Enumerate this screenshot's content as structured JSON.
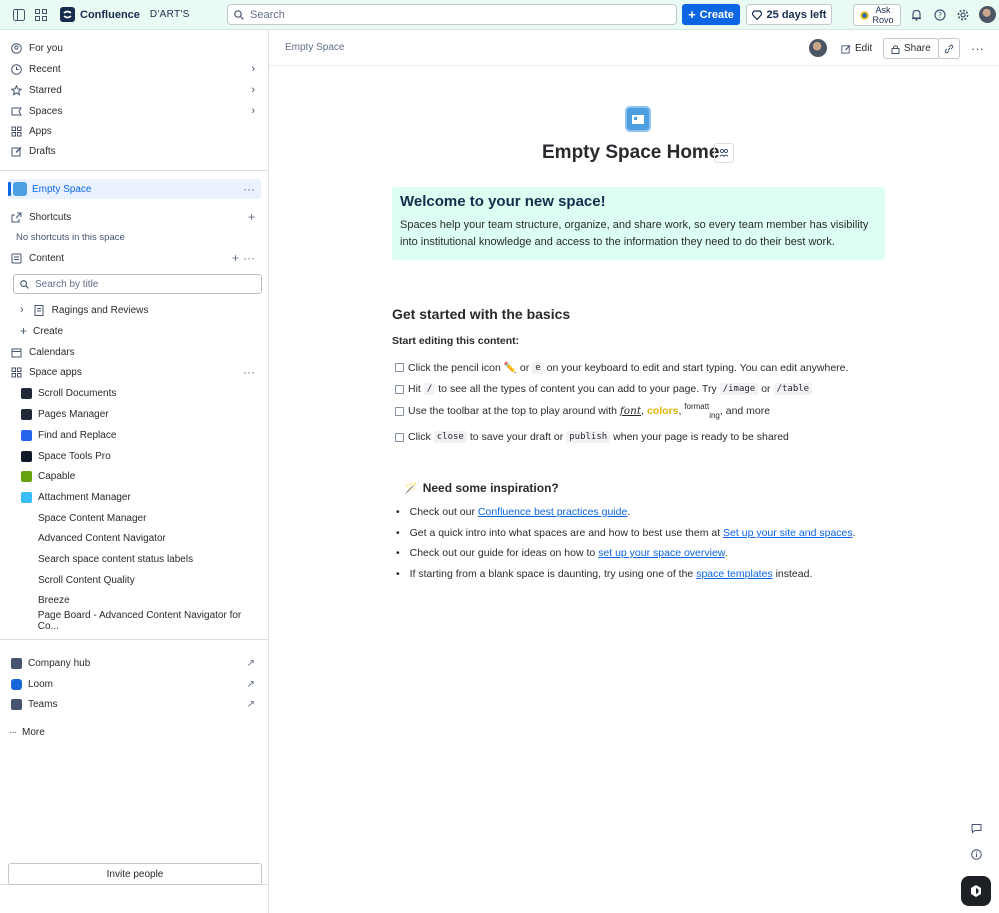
{
  "topbar": {
    "brand": "Confluence",
    "space_tag": "D'ART'S",
    "search_placeholder": "Search",
    "create_label": "Create",
    "trial_label": "25 days left",
    "ask_rovo_line1": "Ask",
    "ask_rovo_line2": "Rovo"
  },
  "sidebar": {
    "top_items": [
      {
        "label": "For you",
        "icon": "user-circle-icon"
      },
      {
        "label": "Recent",
        "icon": "clock-icon"
      },
      {
        "label": "Starred",
        "icon": "star-icon"
      },
      {
        "label": "Spaces",
        "icon": "spaces-icon"
      },
      {
        "label": "Apps",
        "icon": "apps-icon"
      },
      {
        "label": "Drafts",
        "icon": "pencil-icon"
      }
    ],
    "current_space": "Empty Space",
    "shortcuts_label": "Shortcuts",
    "no_shortcuts": "No shortcuts in this space",
    "content_label": "Content",
    "search_placeholder": "Search by title",
    "tree_page": "Ragings and Reviews",
    "create_label": "Create",
    "calendars_label": "Calendars",
    "space_apps_label": "Space apps",
    "apps": [
      {
        "label": "Scroll Documents",
        "color": "#1f2937"
      },
      {
        "label": "Pages Manager",
        "color": "#111827"
      },
      {
        "label": "Find and Replace",
        "color": "#1f2937"
      },
      {
        "label": "Space Tools Pro",
        "color": "#60a5fa"
      },
      {
        "label": "Capable",
        "color": "#2563eb"
      },
      {
        "label": "Attachment Manager",
        "color": "#111827"
      },
      {
        "label": "Space Content Manager",
        "color": "#111827"
      },
      {
        "label": "Advanced Content Navigator",
        "color": "#f5d9a8"
      },
      {
        "label": "Search space content status labels",
        "color": "#65a30d"
      },
      {
        "label": "Scroll Content Quality",
        "color": "#1f2937"
      },
      {
        "label": "Breeze",
        "color": "#38bdf8"
      },
      {
        "label": "Page Board - Advanced Content Navigator for Co...",
        "color": "#f0c9a0"
      }
    ],
    "external": [
      {
        "label": "Company hub",
        "color": "#44546f"
      },
      {
        "label": "Loom",
        "color": "#1868db"
      },
      {
        "label": "Teams",
        "color": "#44546f"
      }
    ],
    "more_label": "More",
    "invite_label": "Invite people"
  },
  "header": {
    "breadcrumb": "Empty Space",
    "edit_label": "Edit",
    "share_label": "Share"
  },
  "page": {
    "title": "Empty Space Home",
    "panel_title": "Welcome to your new space!",
    "panel_text": "Spaces help your team structure, organize, and share work, so every team member has visibility into institutional knowledge and access to the information they need to do their best work.",
    "basics_heading": "Get started with the basics",
    "start_editing": "Start editing this content:",
    "tasks": {
      "t1_a": "Click the pencil icon",
      "t1_b": "or",
      "t1_code": "e",
      "t1_c": "on your keyboard to edit and start typing. You can edit anywhere.",
      "t2_a": "Hit",
      "t2_code1": "/",
      "t2_b": "to see all the types of content you can add to your page. Try",
      "t2_code2": "/image",
      "t2_c": "or",
      "t2_code3": "/table",
      "t3_a": "Use the toolbar at the top to play around with",
      "t3_font": "font",
      "t3_colors": "colors",
      "t3_fmt1": "formatt",
      "t3_fmt2": "ing",
      "t3_b": ", and more",
      "t4_a": "Click",
      "t4_code1": "close",
      "t4_b": "to save your draft or",
      "t4_code2": "publish",
      "t4_c": "when your page is ready to be shared"
    },
    "inspiration_heading": "Need some inspiration?",
    "bullets": {
      "b1_a": "Check out our",
      "b1_link": "Confluence best practices guide",
      "b2_a": "Get a quick intro into what spaces are and how to best use them at",
      "b2_link": "Set up your site and spaces",
      "b3_a": "Check out our guide for ideas on how to",
      "b3_link": "set up your space overview",
      "b4_a": "If starting from a blank space is daunting, try using one of the",
      "b4_link": "space templates",
      "b4_b": "instead."
    }
  }
}
